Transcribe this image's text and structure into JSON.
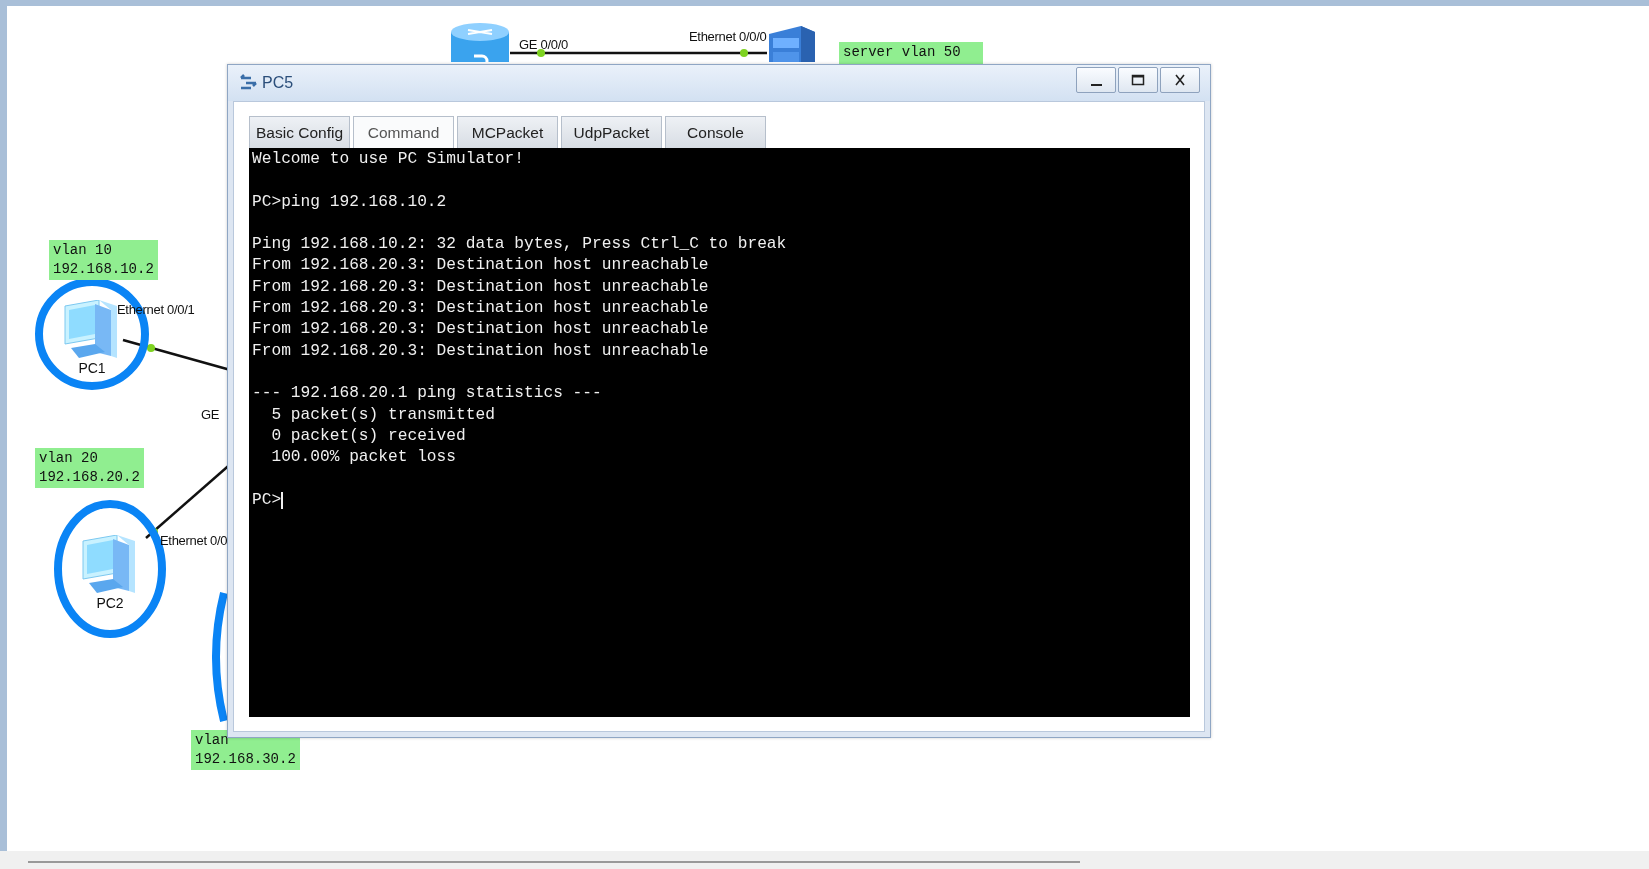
{
  "topology": {
    "devices": [
      {
        "kind": "router"
      },
      {
        "kind": "server"
      },
      {
        "kind": "pc",
        "name": "PC1",
        "highlighted": true
      },
      {
        "kind": "pc",
        "name": "PC2",
        "highlighted": true
      },
      {
        "kind": "pc-hidden",
        "highlighted": true
      }
    ],
    "port_labels": [
      "GE 0/0/0",
      "Ethernet 0/0/0",
      "Ethernet 0/0/1",
      "GE",
      "Ethernet 0/0"
    ],
    "notes": [
      {
        "lines": [
          "server vlan 50"
        ]
      },
      {
        "lines": [
          "vlan 10",
          "192.168.10.2"
        ]
      },
      {
        "lines": [
          "vlan 20",
          "192.168.20.2"
        ]
      },
      {
        "lines": [
          "vlan",
          "192.168.30.2"
        ]
      }
    ]
  },
  "window": {
    "title": "PC5",
    "tabs": [
      {
        "label": "Basic Config",
        "selected": false
      },
      {
        "label": "Command",
        "selected": true
      },
      {
        "label": "MCPacket",
        "selected": false
      },
      {
        "label": "UdpPacket",
        "selected": false
      },
      {
        "label": "Console",
        "selected": false
      }
    ],
    "console": {
      "blocks": [
        [
          "Welcome to use PC Simulator!"
        ],
        [
          "PC>ping 192.168.10.2"
        ],
        [
          "Ping 192.168.10.2: 32 data bytes, Press Ctrl_C to break",
          "From 192.168.20.3: Destination host unreachable",
          "From 192.168.20.3: Destination host unreachable",
          "From 192.168.20.3: Destination host unreachable",
          "From 192.168.20.3: Destination host unreachable",
          "From 192.168.20.3: Destination host unreachable"
        ],
        [
          "--- 192.168.20.1 ping statistics ---",
          "  5 packet(s) transmitted",
          "  0 packet(s) received",
          "  100.00% packet loss"
        ]
      ],
      "prompt": "PC>"
    }
  }
}
